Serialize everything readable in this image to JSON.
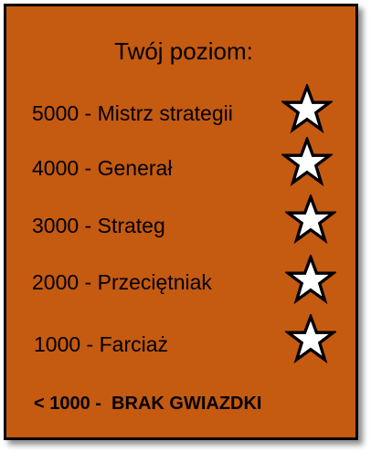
{
  "title": "Twój poziom:",
  "levels": [
    {
      "text": "5000 - Mistrz strategii",
      "star": "star-icon"
    },
    {
      "text": "4000 - Generał",
      "star": "star-icon"
    },
    {
      "text": "3000 - Strateg",
      "star": "star-icon"
    },
    {
      "text": "2000 - Przeciętniak",
      "star": "star-icon"
    },
    {
      "text": "1000 - Farciaż",
      "star": "star-icon"
    }
  ],
  "footer": "< 1000 -  BRAK GWIAZDKI",
  "colors": {
    "panel": "#c55a11",
    "border": "#000000",
    "star_fill": "#ffffff",
    "star_stroke": "#000000"
  }
}
